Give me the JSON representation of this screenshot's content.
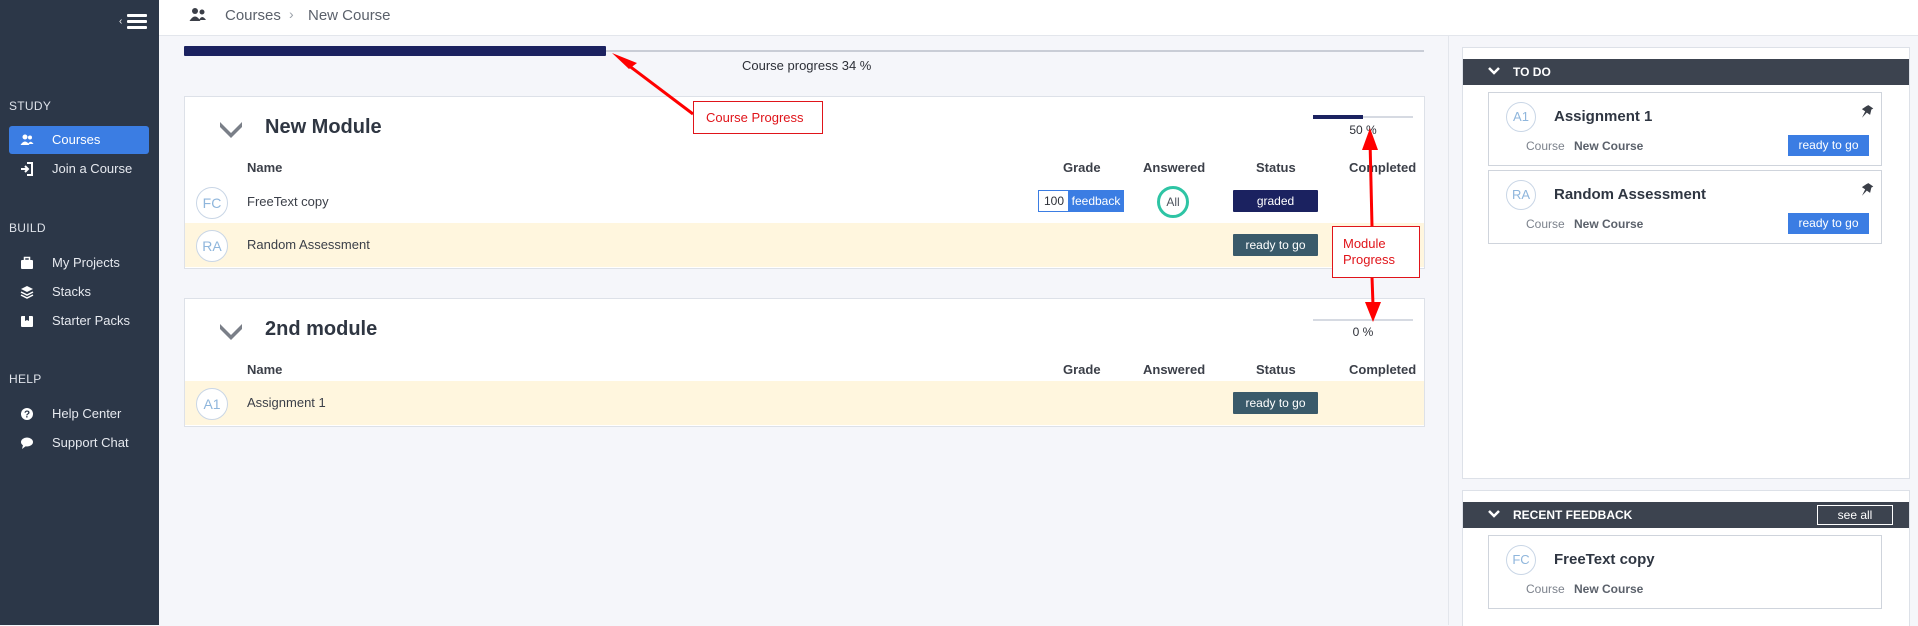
{
  "sidebar": {
    "sections": [
      {
        "heading": "STUDY",
        "items": [
          {
            "label": "Courses",
            "icon": "users-icon",
            "active": true
          },
          {
            "label": "Join a Course",
            "icon": "sign-in-icon"
          }
        ]
      },
      {
        "heading": "BUILD",
        "items": [
          {
            "label": "My Projects",
            "icon": "briefcase-icon"
          },
          {
            "label": "Stacks",
            "icon": "layers-icon"
          },
          {
            "label": "Starter Packs",
            "icon": "box-icon"
          }
        ]
      },
      {
        "heading": "HELP",
        "items": [
          {
            "label": "Help Center",
            "icon": "question-icon"
          },
          {
            "label": "Support Chat",
            "icon": "chat-icon"
          }
        ]
      }
    ]
  },
  "breadcrumb": {
    "root": "Courses",
    "current": "New Course"
  },
  "course_progress": {
    "label": "Course progress 34 %",
    "value": 34
  },
  "columns": {
    "name": "Name",
    "grade": "Grade",
    "answered": "Answered",
    "status": "Status",
    "completed": "Completed"
  },
  "modules": [
    {
      "title": "New Module",
      "progress_label": "50 %",
      "progress": 50,
      "rows": [
        {
          "initials": "FC",
          "name": "FreeText copy",
          "grade": "100",
          "feedback": "feedback",
          "answered": "All",
          "status": "graded"
        },
        {
          "initials": "RA",
          "name": "Random Assessment",
          "status": "ready to go"
        }
      ]
    },
    {
      "title": "2nd module",
      "progress_label": "0 %",
      "progress": 0,
      "rows": [
        {
          "initials": "A1",
          "name": "Assignment 1",
          "status": "ready to go"
        }
      ]
    }
  ],
  "todo": {
    "heading": "TO DO",
    "items": [
      {
        "initials": "A1",
        "title": "Assignment 1",
        "course_label": "Course",
        "course": "New Course",
        "action": "ready to go"
      },
      {
        "initials": "RA",
        "title": "Random Assessment",
        "course_label": "Course",
        "course": "New Course",
        "action": "ready to go"
      }
    ]
  },
  "recent_feedback": {
    "heading": "RECENT FEEDBACK",
    "see_all": "see all",
    "items": [
      {
        "initials": "FC",
        "title": "FreeText copy",
        "course_label": "Course",
        "course": "New Course"
      }
    ]
  },
  "annotations": {
    "course": "Course Progress",
    "module": "Module Progress"
  },
  "colors": {
    "sidebar": "#2c3748",
    "accent": "#3b7de3",
    "progress": "#1b2260",
    "annotation": "#e0141a"
  }
}
